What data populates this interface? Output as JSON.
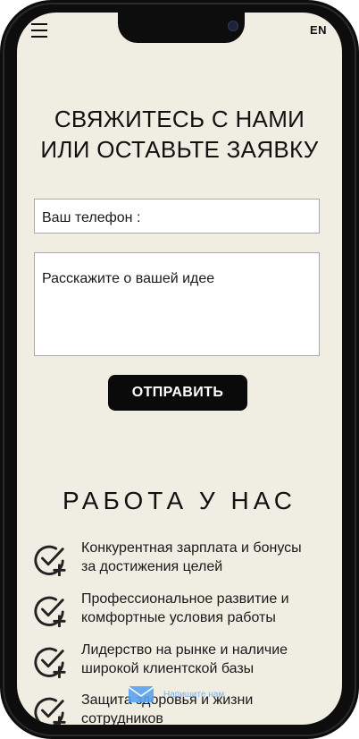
{
  "header": {
    "lang_label": "EN"
  },
  "contact": {
    "title_line1": "СВЯЖИТЕСЬ С НАМИ",
    "title_line2": "ИЛИ ОСТАВЬТЕ ЗАЯВКУ",
    "phone_placeholder": "Ваш телефон :",
    "idea_placeholder": "Расскажите о вашей идее",
    "submit_label": "ОТПРАВИТЬ"
  },
  "careers": {
    "title": "РАБОТА У НАС",
    "items": [
      {
        "line1": "Конкурентная зарплата и бонусы",
        "line2": "за достижения целей"
      },
      {
        "line1": "Профессиональное развитие и",
        "line2": "комфортные условия работы"
      },
      {
        "line1": "Лидерство на рынке и наличие",
        "line2": "широкой клиентской базы"
      },
      {
        "line1": "Защита здоровья и жизни",
        "line2": "сотрудников"
      }
    ]
  },
  "chat_widget": {
    "label": "Напишите нам"
  },
  "icons": {
    "menu": "hamburger-menu-icon",
    "benefit": "check-plus-icon",
    "chat": "envelope-icon"
  },
  "colors": {
    "page_background": "#f0eee3",
    "button_background": "#0a0a0a",
    "chat_accent": "#7fb2e6"
  }
}
